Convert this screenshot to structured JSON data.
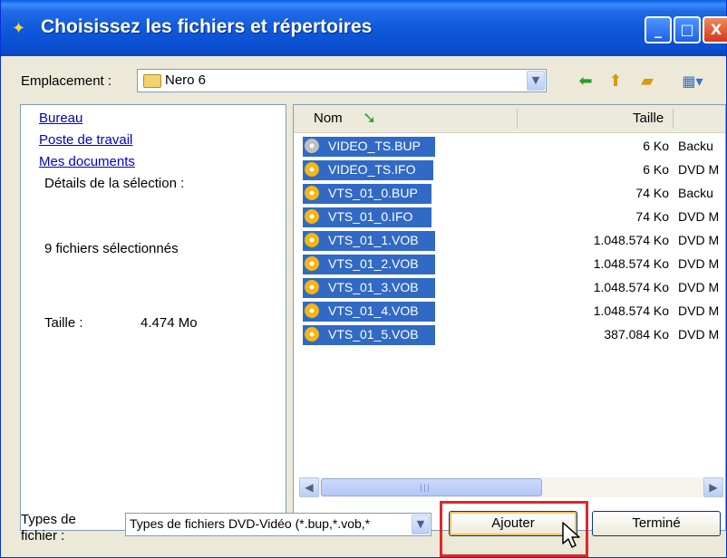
{
  "window": {
    "title": "Choisissez les fichiers et répertoires",
    "controls": {
      "minimize": "_",
      "maximize": "□",
      "close": "X"
    }
  },
  "location": {
    "label": "Emplacement :",
    "value": "Nero 6"
  },
  "places": [
    "Bureau",
    "Poste de travail",
    "Mes documents"
  ],
  "details": {
    "heading": "Détails de la sélection :",
    "selected_count": "9 fichiers sélectionnés",
    "size_label": "Taille :",
    "size_value": "4.474 Mo"
  },
  "list": {
    "columns": {
      "name": "Nom",
      "size": "Taille"
    },
    "files": [
      {
        "name": "VIDEO_TS.BUP",
        "size": "6 Ko",
        "type": "Backu",
        "icon": "gray"
      },
      {
        "name": "VIDEO_TS.IFO",
        "size": "6 Ko",
        "type": "DVD M",
        "icon": "yellow"
      },
      {
        "name": "VTS_01_0.BUP",
        "size": "74 Ko",
        "type": "Backu",
        "icon": "yellow"
      },
      {
        "name": "VTS_01_0.IFO",
        "size": "74 Ko",
        "type": "DVD M",
        "icon": "yellow"
      },
      {
        "name": "VTS_01_1.VOB",
        "size": "1.048.574 Ko",
        "type": "DVD M",
        "icon": "yellow"
      },
      {
        "name": "VTS_01_2.VOB",
        "size": "1.048.574 Ko",
        "type": "DVD M",
        "icon": "yellow"
      },
      {
        "name": "VTS_01_3.VOB",
        "size": "1.048.574 Ko",
        "type": "DVD M",
        "icon": "yellow"
      },
      {
        "name": "VTS_01_4.VOB",
        "size": "1.048.574 Ko",
        "type": "DVD M",
        "icon": "yellow"
      },
      {
        "name": "VTS_01_5.VOB",
        "size": "387.084 Ko",
        "type": "DVD M",
        "icon": "yellow"
      }
    ]
  },
  "filetype": {
    "label_line1": "Types de",
    "label_line2": "fichier :",
    "value": "Types de fichiers DVD-Vidéo (*.bup,*.vob,*"
  },
  "buttons": {
    "add": "Ajouter",
    "done": "Terminé"
  },
  "colors": {
    "titlebar": "#0b4fd0",
    "selection": "#316ac5",
    "highlight": "#e0262a"
  }
}
